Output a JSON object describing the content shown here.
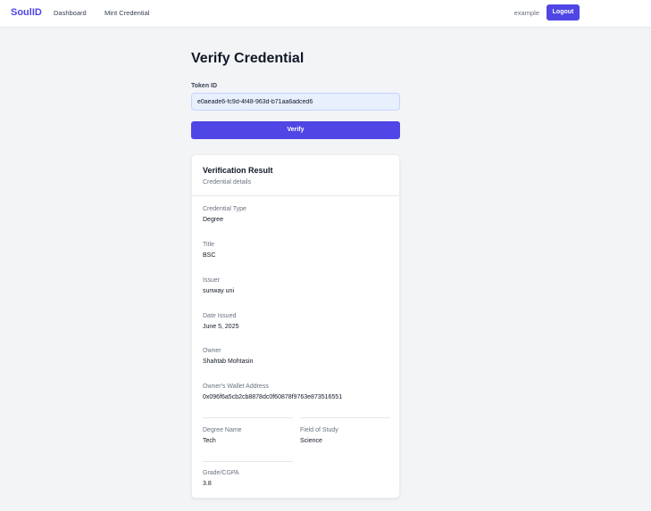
{
  "nav": {
    "brand": "SoulID",
    "links": [
      "Dashboard",
      "Mint Credential"
    ],
    "username": "example",
    "logout_label": "Logout"
  },
  "page": {
    "title": "Verify Credential",
    "token_label": "Token ID",
    "token_value": "e0aeade6-fc9d-4f48-963d-b71aa6adced6",
    "verify_label": "Verify"
  },
  "result": {
    "title": "Verification Result",
    "subtitle": "Credential details",
    "fields": [
      {
        "label": "Credential Type",
        "value": "Degree"
      },
      {
        "label": "Title",
        "value": "BSC"
      },
      {
        "label": "Issuer",
        "value": "sunway uni"
      },
      {
        "label": "Date Issued",
        "value": "June 5, 2025"
      },
      {
        "label": "Owner",
        "value": "Shahtab Mohtasin"
      },
      {
        "label": "Owner's Wallet Address",
        "value": "0x096f6a5cb2cb8878dc0f60878f9763e873516551"
      },
      {
        "label": "Degree Name",
        "value": "Tech"
      },
      {
        "label": "Field of Study",
        "value": "Science"
      },
      {
        "label": "Grade/CGPA",
        "value": "3.8"
      }
    ]
  }
}
